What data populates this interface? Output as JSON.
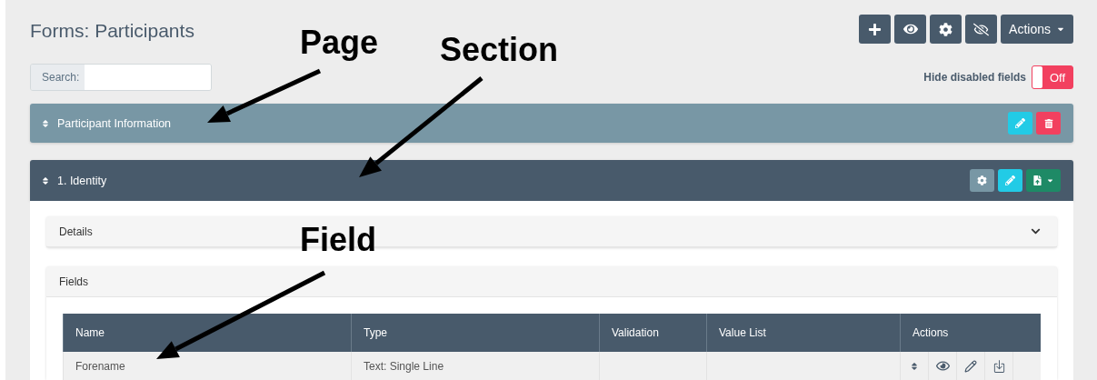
{
  "title": "Forms: Participants",
  "toolbar": [
    {
      "kind": "add"
    },
    {
      "kind": "view"
    },
    {
      "kind": "settings"
    },
    {
      "kind": "hide"
    },
    {
      "kind": "dropdown",
      "label": "Actions"
    }
  ],
  "search": {
    "label": "Search:"
  },
  "toggle": {
    "label": "Hide disabled fields",
    "text": "Off",
    "on": false
  },
  "page": {
    "title": "Participant Information"
  },
  "section": {
    "title": "1. Identity"
  },
  "details": {
    "title": "Details",
    "expanded": false
  },
  "fields": {
    "title": "Fields",
    "columns": [
      "Name",
      "Type",
      "Validation",
      "Value List",
      "Actions"
    ],
    "rows": [
      {
        "name": "Forename",
        "type": "Text: Single Line"
      }
    ]
  },
  "annotations": [
    {
      "text": "Page"
    },
    {
      "text": "Section"
    },
    {
      "text": "Field"
    }
  ]
}
